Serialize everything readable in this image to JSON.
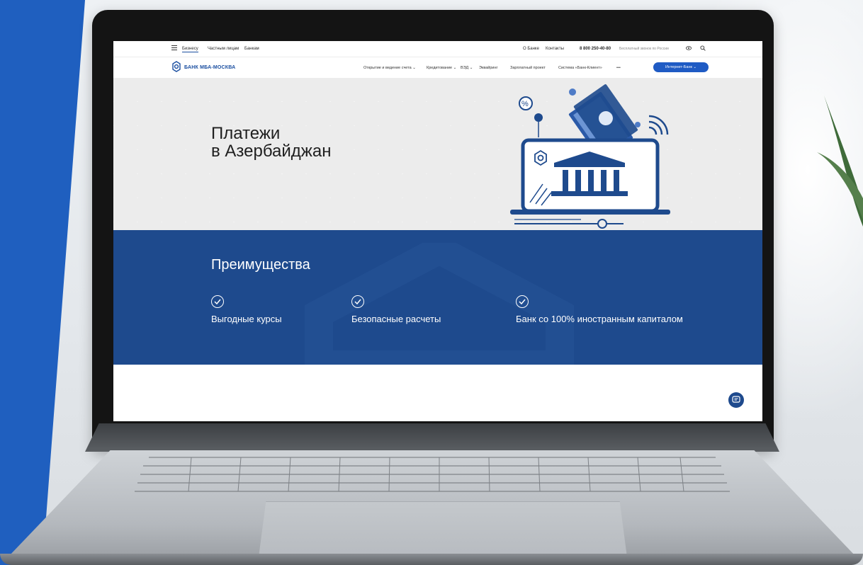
{
  "topbar": {
    "segments": [
      "Бизнесу",
      "Частным лицам",
      "Банкам"
    ],
    "links": [
      "О Банке",
      "Контакты"
    ],
    "phone": "8 800 250-40-80",
    "phone_note": "Бесплатный звонок по России"
  },
  "navbar": {
    "logo_text": "БАНК МБА-МОСКВА",
    "items": [
      "Открытие и ведение счета ⌄",
      "Кредитование ⌄",
      "ВЭД ⌄",
      "Эквайринг",
      "Зарплатный проект",
      "Система «Банк-Клиент»",
      "•••"
    ],
    "internet_bank": "Интернет-Банк ⌄"
  },
  "hero": {
    "title_line1": "Платежи",
    "title_line2": "в Азербайджан"
  },
  "advantages": {
    "title": "Преимущества",
    "items": [
      "Выгодные курсы",
      "Безопасные расчеты",
      "Банк со 100% иностранным капиталом"
    ]
  },
  "colors": {
    "brand_blue": "#1e4a8d",
    "button_blue": "#1f5bc4",
    "accent_blue": "#1f5fbf"
  }
}
